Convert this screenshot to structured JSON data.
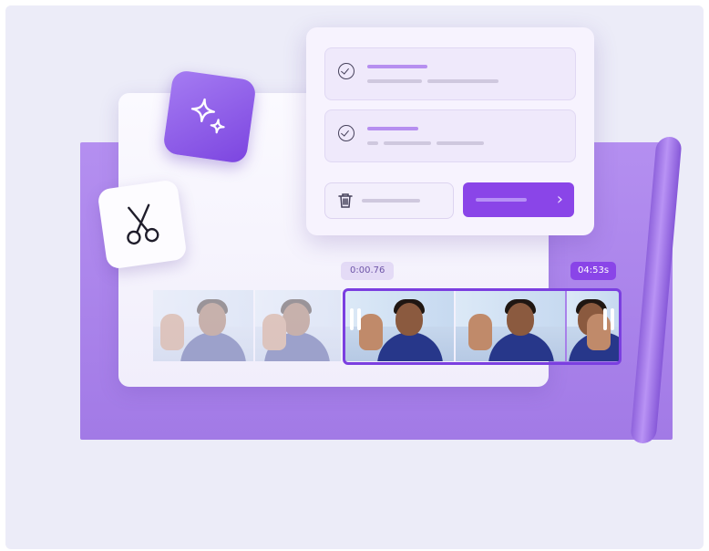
{
  "timeline": {
    "start_time": "0:00.76",
    "end_time": "04:53s"
  },
  "colors": {
    "accent": "#8a45e8",
    "backdrop": "#a27ae6",
    "panel": "#f7f3fe"
  },
  "icons": [
    "sparkles-icon",
    "scissors-icon",
    "check-circle-icon",
    "trash-icon",
    "chevron-right-icon"
  ]
}
